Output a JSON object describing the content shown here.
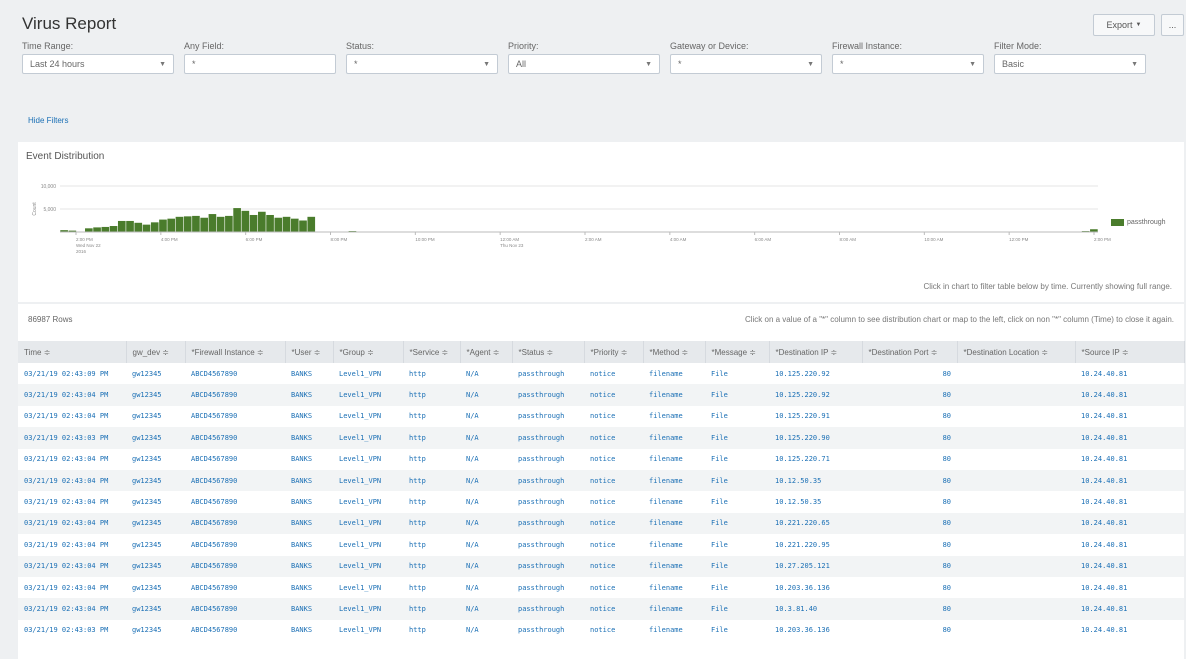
{
  "header": {
    "title": "Virus Report",
    "export_label": "Export",
    "more_label": "..."
  },
  "filters": [
    {
      "label": "Time Range:",
      "value": "Last 24 hours"
    },
    {
      "label": "Any Field:",
      "value": "*"
    },
    {
      "label": "Status:",
      "value": "*"
    },
    {
      "label": "Priority:",
      "value": "All"
    },
    {
      "label": "Gateway or Device:",
      "value": "*"
    },
    {
      "label": "Firewall Instance:",
      "value": "*"
    },
    {
      "label": "Filter Mode:",
      "value": "Basic"
    }
  ],
  "hide_filters": "Hide Filters",
  "chart_panel": {
    "title": "Event Distribution",
    "note": "Click in chart to filter table below by time. Currently showing full range."
  },
  "chart_data": {
    "type": "bar",
    "title": "",
    "xlabel": "",
    "ylabel": "Count",
    "ylim": [
      0,
      10000
    ],
    "y_ticks": [
      "10,000",
      "5,000"
    ],
    "x_tick_labels": [
      [
        "2:00 PM",
        "Wed Nov 22",
        "2016"
      ],
      [
        "4:00 PM"
      ],
      [
        "6:00 PM"
      ],
      [
        "8:00 PM"
      ],
      [
        "10:00 PM"
      ],
      [
        "12:00 AM",
        "Thu Nov 23"
      ],
      [
        "2:00 AM"
      ],
      [
        "4:00 AM"
      ],
      [
        "6:00 AM"
      ],
      [
        "8:00 AM"
      ],
      [
        "10:00 AM"
      ],
      [
        "12:00 PM"
      ],
      [
        "2:00 PM"
      ]
    ],
    "series": [
      {
        "name": "passthrough",
        "color": "#4a7c2c",
        "values": [
          400,
          300,
          0,
          800,
          1000,
          1100,
          1300,
          2400,
          2400,
          2000,
          1600,
          2100,
          2700,
          2900,
          3300,
          3400,
          3500,
          3100,
          3900,
          3300,
          3500,
          5200,
          4600,
          3700,
          4400,
          3700,
          3100,
          3300,
          2900,
          2500,
          3300,
          0,
          0,
          0,
          0,
          200,
          0,
          0,
          0,
          0,
          0,
          0,
          0,
          0,
          0,
          0,
          0,
          0,
          0,
          0,
          0,
          0,
          0,
          0,
          0,
          0,
          0,
          0,
          0,
          0,
          0,
          0,
          0,
          0,
          0,
          0,
          0,
          0,
          0,
          0,
          0,
          0,
          0,
          0,
          0,
          0,
          0,
          0,
          0,
          0,
          0,
          0,
          0,
          0,
          0,
          0,
          0,
          0,
          0,
          0,
          0,
          0,
          0,
          0,
          0,
          0,
          0,
          0,
          0,
          0,
          0,
          0,
          0,
          0,
          0,
          0,
          0,
          0,
          0,
          0,
          0,
          0,
          0,
          0,
          0,
          0,
          0,
          0,
          0,
          0,
          0,
          0,
          0,
          0,
          200,
          600
        ]
      }
    ],
    "legend": "right"
  },
  "table": {
    "count_label": "86987 Rows",
    "hint": "Click on a value of a \"*\" column to see distribution chart or map to the left, click on non \"*\" column (Time) to close it again.",
    "columns": [
      "Time ≑",
      "gw_dev ≑",
      "*Firewall Instance ≑",
      "*User ≑",
      "*Group ≑",
      "*Service ≑",
      "*Agent ≑",
      "*Status ≑",
      "*Priority ≑",
      "*Method ≑",
      "*Message ≑",
      "*Destination IP ≑",
      "*Destination Port ≑",
      "*Destination Location ≑",
      "*Source IP ≑"
    ],
    "rows": [
      [
        "03/21/19 02:43:09 PM",
        "gw12345",
        "ABCD4567890",
        "BANKS",
        "Level1_VPN",
        "http",
        "N/A",
        "passthrough",
        "notice",
        "filename",
        "File",
        "10.125.220.92",
        "80",
        "",
        "10.24.40.81"
      ],
      [
        "03/21/19 02:43:04 PM",
        "gw12345",
        "ABCD4567890",
        "BANKS",
        "Level1_VPN",
        "http",
        "N/A",
        "passthrough",
        "notice",
        "filename",
        "File",
        "10.125.220.92",
        "80",
        "",
        "10.24.40.81"
      ],
      [
        "03/21/19 02:43:04 PM",
        "gw12345",
        "ABCD4567890",
        "BANKS",
        "Level1_VPN",
        "http",
        "N/A",
        "passthrough",
        "notice",
        "filename",
        "File",
        "10.125.220.91",
        "80",
        "",
        "10.24.40.81"
      ],
      [
        "03/21/19 02:43:03 PM",
        "gw12345",
        "ABCD4567890",
        "BANKS",
        "Level1_VPN",
        "http",
        "N/A",
        "passthrough",
        "notice",
        "filename",
        "File",
        "10.125.220.90",
        "80",
        "",
        "10.24.40.81"
      ],
      [
        "03/21/19 02:43:04 PM",
        "gw12345",
        "ABCD4567890",
        "BANKS",
        "Level1_VPN",
        "http",
        "N/A",
        "passthrough",
        "notice",
        "filename",
        "File",
        "10.125.220.71",
        "80",
        "",
        "10.24.40.81"
      ],
      [
        "03/21/19 02:43:04 PM",
        "gw12345",
        "ABCD4567890",
        "BANKS",
        "Level1_VPN",
        "http",
        "N/A",
        "passthrough",
        "notice",
        "filename",
        "File",
        "10.12.50.35",
        "80",
        "",
        "10.24.40.81"
      ],
      [
        "03/21/19 02:43:04 PM",
        "gw12345",
        "ABCD4567890",
        "BANKS",
        "Level1_VPN",
        "http",
        "N/A",
        "passthrough",
        "notice",
        "filename",
        "File",
        "10.12.50.35",
        "80",
        "",
        "10.24.40.81"
      ],
      [
        "03/21/19 02:43:04 PM",
        "gw12345",
        "ABCD4567890",
        "BANKS",
        "Level1_VPN",
        "http",
        "N/A",
        "passthrough",
        "notice",
        "filename",
        "File",
        "10.221.220.65",
        "80",
        "",
        "10.24.40.81"
      ],
      [
        "03/21/19 02:43:04 PM",
        "gw12345",
        "ABCD4567890",
        "BANKS",
        "Level1_VPN",
        "http",
        "N/A",
        "passthrough",
        "notice",
        "filename",
        "File",
        "10.221.220.95",
        "80",
        "",
        "10.24.40.81"
      ],
      [
        "03/21/19 02:43:04 PM",
        "gw12345",
        "ABCD4567890",
        "BANKS",
        "Level1_VPN",
        "http",
        "N/A",
        "passthrough",
        "notice",
        "filename",
        "File",
        "10.27.205.121",
        "80",
        "",
        "10.24.40.81"
      ],
      [
        "03/21/19 02:43:04 PM",
        "gw12345",
        "ABCD4567890",
        "BANKS",
        "Level1_VPN",
        "http",
        "N/A",
        "passthrough",
        "notice",
        "filename",
        "File",
        "10.203.36.136",
        "80",
        "",
        "10.24.40.81"
      ],
      [
        "03/21/19 02:43:04 PM",
        "gw12345",
        "ABCD4567890",
        "BANKS",
        "Level1_VPN",
        "http",
        "N/A",
        "passthrough",
        "notice",
        "filename",
        "File",
        "10.3.81.40",
        "80",
        "",
        "10.24.40.81"
      ],
      [
        "03/21/19 02:43:03 PM",
        "gw12345",
        "ABCD4567890",
        "BANKS",
        "Level1_VPN",
        "http",
        "N/A",
        "passthrough",
        "notice",
        "filename",
        "File",
        "10.203.36.136",
        "80",
        "",
        "10.24.40.81"
      ]
    ]
  }
}
